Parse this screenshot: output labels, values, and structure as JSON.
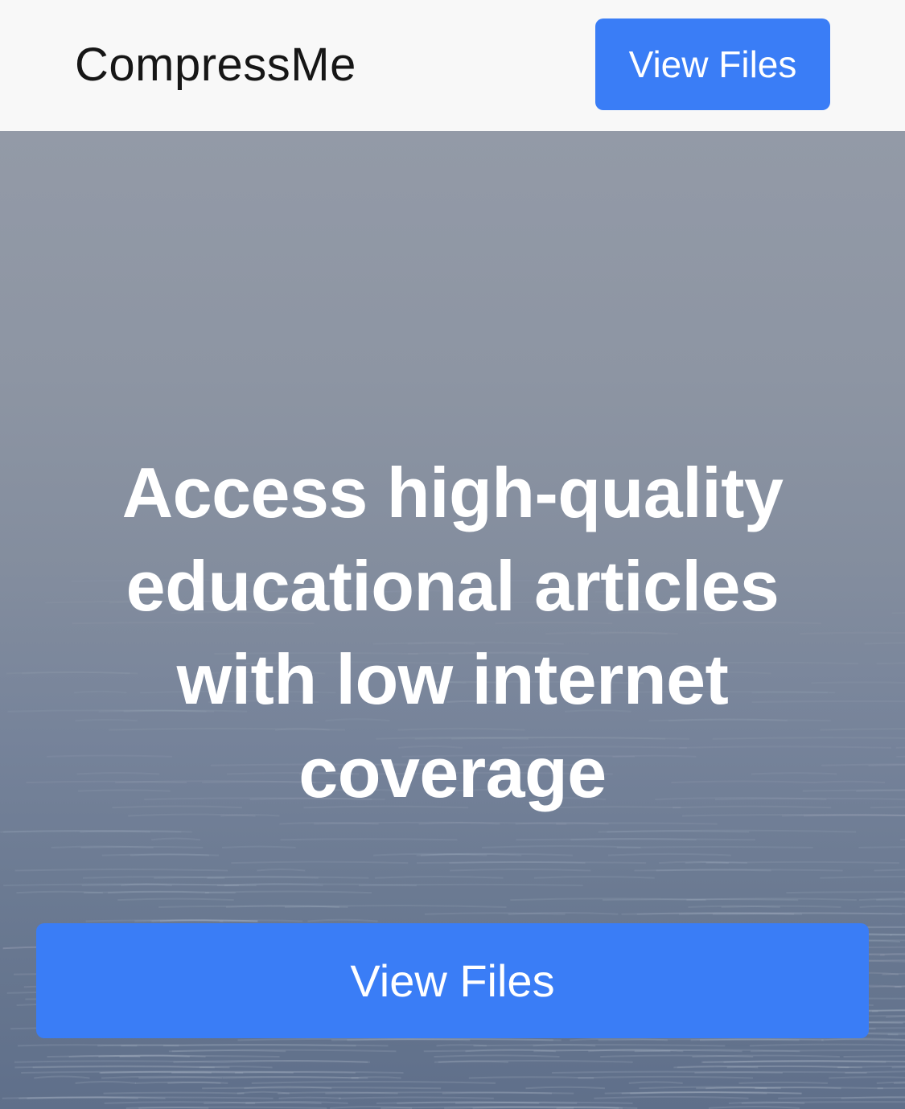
{
  "navbar": {
    "brand": "CompressMe",
    "view_files_label": "View Files"
  },
  "hero": {
    "title": "Access high-quality educational articles with low internet coverage",
    "cta_label": "View Files"
  },
  "colors": {
    "primary_button": "#3a7df6",
    "navbar_background": "#f8f8f8",
    "hero_text": "#ffffff"
  }
}
